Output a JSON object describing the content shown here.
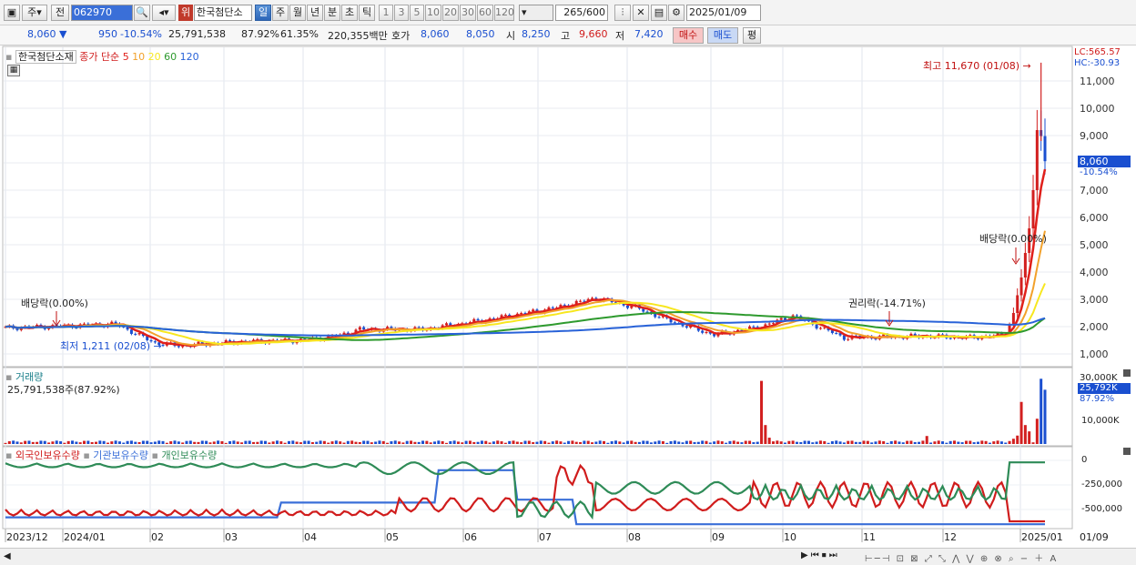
{
  "toolbar": {
    "mode": "주",
    "mode2": "전",
    "code": "062970",
    "warn_badge": "위",
    "stock_name": "한국첨단소",
    "periods": [
      "일",
      "주",
      "월",
      "년",
      "분",
      "초",
      "틱"
    ],
    "period_selected": "일",
    "intervals": [
      "1",
      "3",
      "5",
      "10",
      "20",
      "30",
      "60",
      "120"
    ],
    "count": "265",
    "count_total": "/600",
    "date": "2025/01/09"
  },
  "quote": {
    "price": "8,060",
    "change_arrow": "▼",
    "change": "950",
    "change_pct": "-10.54%",
    "volume": "25,791,538",
    "volume_ratio": "87.92%",
    "rate2": "61.35%",
    "amount": "220,355백만",
    "ask_label": "호가",
    "ask": "8,060",
    "bid": "8,050",
    "open_label": "시",
    "open": "8,250",
    "high_label": "고",
    "high": "9,660",
    "low_label": "저",
    "low": "7,420",
    "buy_label": "매수",
    "sell_label": "매도",
    "eval_label": "평"
  },
  "price_panel": {
    "title": "한국첨단소재",
    "ma_prefix": "종가 단순",
    "ma_periods": [
      "5",
      "10",
      "20",
      "60",
      "120"
    ],
    "ma_colors": [
      "#e0201b",
      "#f2a12b",
      "#f7e71f",
      "#2e9a2e",
      "#2862d8"
    ],
    "lc": "LC:565.57",
    "hc": "HC:-30.93",
    "last_price": "8,060",
    "last_change": "-10.54%",
    "yticks": [
      "11,000",
      "10,000",
      "9,000",
      "8,000",
      "7,000",
      "6,000",
      "5,000",
      "4,000",
      "3,000",
      "2,000",
      "1,000"
    ],
    "annotations": {
      "max": "최고 11,670 (01/08)",
      "min": "최저 1,211 (02/08)",
      "div1": "배당락(0.00%)",
      "div2": "배당락(0.00%)",
      "rights": "권리락(-14.71%)"
    }
  },
  "volume_panel": {
    "title": "거래량",
    "value": "25,791,538주(87.92%)",
    "yticks": [
      "30,000K",
      "10,000K"
    ],
    "last": "25,792K",
    "last_pct": "87.92%"
  },
  "holding_panel": {
    "series": [
      "외국인보유수량",
      "기관보유수량",
      "개인보유수량"
    ],
    "series_colors": [
      "#d01c1c",
      "#3a6fd8",
      "#2e8b57"
    ],
    "yticks": [
      "0",
      "-250,000",
      "-500,000"
    ]
  },
  "xaxis": [
    "2023/12",
    "2024/01",
    "02",
    "03",
    "04",
    "05",
    "06",
    "07",
    "08",
    "09",
    "10",
    "11",
    "12",
    "2025/01"
  ],
  "xaxis_right": "01/09",
  "chart_data": [
    {
      "type": "line",
      "title": "한국첨단소재",
      "ylabel": "",
      "ylim": [
        800,
        12000
      ],
      "x": [
        "2023-12",
        "2024-01",
        "2024-02",
        "2024-03",
        "2024-04",
        "2024-05",
        "2024-06",
        "2024-07",
        "2024-08",
        "2024-09",
        "2024-10",
        "2024-11",
        "2024-12",
        "2025-01-08",
        "2025-01-09"
      ],
      "series": [
        {
          "name": "종가",
          "values": [
            2000,
            2050,
            1350,
            1500,
            1600,
            1900,
            2200,
            3050,
            1800,
            2300,
            1600,
            1700,
            1600,
            8980,
            8060
          ]
        }
      ]
    },
    {
      "type": "bar",
      "title": "거래량",
      "ylim": [
        0,
        32000
      ],
      "x": [
        "2023-12",
        "2024-01",
        "2024-02",
        "2024-03",
        "2024-04",
        "2024-05",
        "2024-06",
        "2024-07",
        "2024-08",
        "2024-09",
        "2024-10",
        "2024-11",
        "2024-12",
        "2025-01-08",
        "2025-01-09"
      ],
      "values": [
        900,
        1500,
        1200,
        1000,
        800,
        900,
        1300,
        1500,
        1000,
        30000,
        900,
        3800,
        1000,
        31000,
        25792
      ]
    }
  ]
}
